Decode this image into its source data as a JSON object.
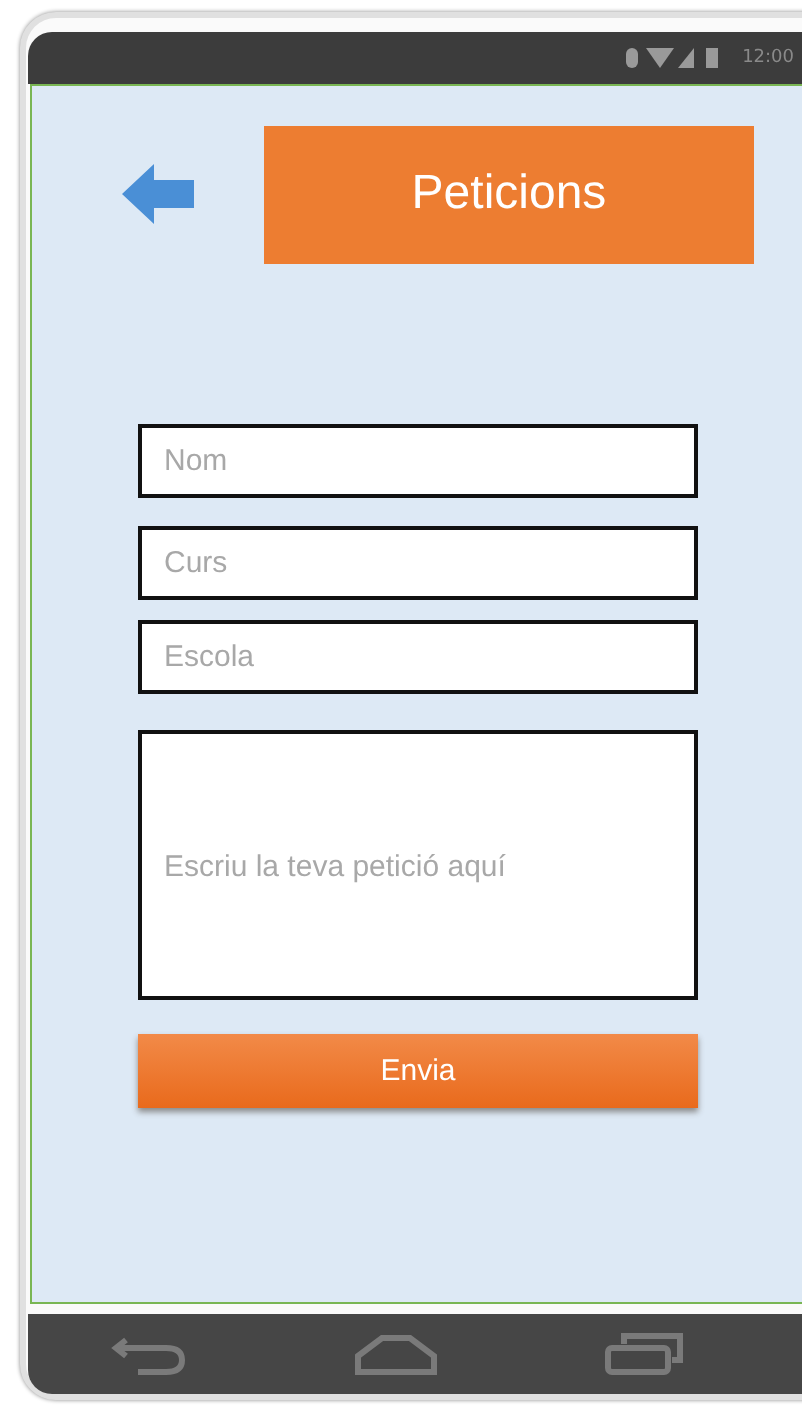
{
  "status_bar": {
    "time": "12:00"
  },
  "header": {
    "title": "Peticions"
  },
  "form": {
    "fields": [
      {
        "kind": "line",
        "placeholder": "Nom"
      },
      {
        "kind": "line",
        "placeholder": "Curs"
      },
      {
        "kind": "line",
        "placeholder": "Escola"
      },
      {
        "kind": "area",
        "placeholder": "Escriu la teva petició aquí"
      }
    ],
    "submit": "Envia"
  }
}
